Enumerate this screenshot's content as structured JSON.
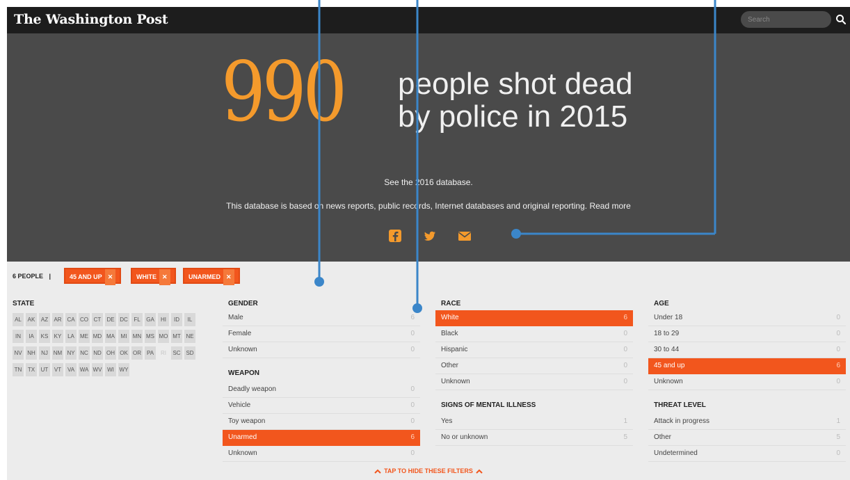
{
  "header": {
    "logo_text": "The Washington Post",
    "search_placeholder": "Search",
    "search_icon": "magnifier-icon"
  },
  "hero": {
    "big_number": "990",
    "headline_line1": "people shot dead",
    "headline_line2": "by police in 2015",
    "link_2016": "See the 2016 database.",
    "description": "This database is based on news reports, public records, Internet databases and original reporting.",
    "read_more": "Read more",
    "share_icons": [
      "facebook-icon",
      "twitter-icon",
      "email-icon"
    ]
  },
  "filters": {
    "count_label": "6 PEOPLE",
    "separator": "|",
    "chips": [
      {
        "label": "45 AND UP",
        "remove": "✕"
      },
      {
        "label": "WHITE",
        "remove": "✕"
      },
      {
        "label": "UNARMED",
        "remove": "✕"
      }
    ],
    "state": {
      "title": "STATE",
      "items": [
        "AL",
        "AK",
        "AZ",
        "AR",
        "CA",
        "CO",
        "CT",
        "DE",
        "DC",
        "FL",
        "GA",
        "HI",
        "ID",
        "IL",
        "IN",
        "IA",
        "KS",
        "KY",
        "LA",
        "ME",
        "MD",
        "MA",
        "MI",
        "MN",
        "MS",
        "MO",
        "MT",
        "NE",
        "NV",
        "NH",
        "NJ",
        "NM",
        "NY",
        "NC",
        "ND",
        "OH",
        "OK",
        "OR",
        "PA",
        "RI",
        "SC",
        "SD",
        "TN",
        "TX",
        "UT",
        "VT",
        "VA",
        "WA",
        "WV",
        "WI",
        "WY"
      ],
      "dimmed": [
        "RI"
      ]
    },
    "gender": {
      "title": "GENDER",
      "rows": [
        {
          "label": "Male",
          "count": "6"
        },
        {
          "label": "Female",
          "count": "0"
        },
        {
          "label": "Unknown",
          "count": "0"
        }
      ]
    },
    "weapon": {
      "title": "WEAPON",
      "rows": [
        {
          "label": "Deadly weapon",
          "count": "0"
        },
        {
          "label": "Vehicle",
          "count": "0"
        },
        {
          "label": "Toy weapon",
          "count": "0"
        },
        {
          "label": "Unarmed",
          "count": "6",
          "selected": true
        },
        {
          "label": "Unknown",
          "count": "0"
        }
      ]
    },
    "race": {
      "title": "RACE",
      "rows": [
        {
          "label": "White",
          "count": "6",
          "selected": true
        },
        {
          "label": "Black",
          "count": "0"
        },
        {
          "label": "Hispanic",
          "count": "0"
        },
        {
          "label": "Other",
          "count": "0"
        },
        {
          "label": "Unknown",
          "count": "0"
        }
      ]
    },
    "mental_illness": {
      "title": "SIGNS OF MENTAL ILLNESS",
      "rows": [
        {
          "label": "Yes",
          "count": "1"
        },
        {
          "label": "No or unknown",
          "count": "5"
        }
      ]
    },
    "age": {
      "title": "AGE",
      "rows": [
        {
          "label": "Under 18",
          "count": "0"
        },
        {
          "label": "18 to 29",
          "count": "0"
        },
        {
          "label": "30 to 44",
          "count": "0"
        },
        {
          "label": "45 and up",
          "count": "6",
          "selected": true
        },
        {
          "label": "Unknown",
          "count": "0"
        }
      ]
    },
    "threat": {
      "title": "THREAT LEVEL",
      "rows": [
        {
          "label": "Attack in progress",
          "count": "1"
        },
        {
          "label": "Other",
          "count": "5"
        },
        {
          "label": "Undetermined",
          "count": "0"
        }
      ]
    },
    "tap_hide": "TAP TO HIDE THESE FILTERS"
  },
  "colors": {
    "accent_orange": "#f2561d",
    "number_orange": "#f49a2c",
    "callout_blue": "#3b86c9",
    "hero_bg": "#4a4a4a",
    "topbar_bg": "#1d1d1d",
    "filter_bg": "#ececec"
  }
}
